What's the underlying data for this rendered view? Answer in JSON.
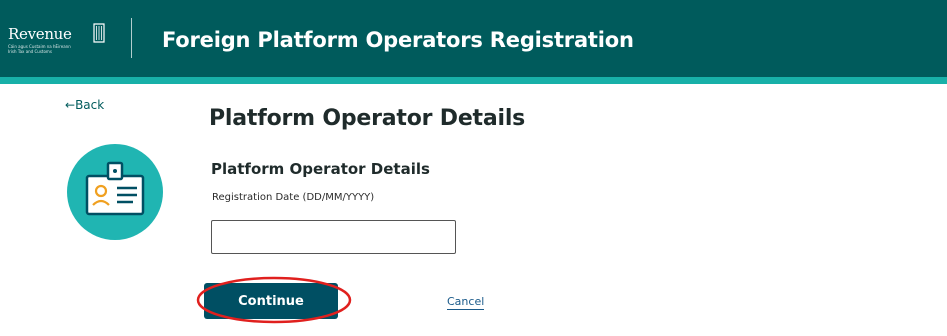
{
  "header": {
    "logo_text": "Revenue",
    "logo_subtext": [
      "Cáin agus Custaim na hÉireann",
      "Irish Tax and Customs"
    ],
    "title": "Foreign Platform Operators Registration"
  },
  "nav": {
    "back_label": "Back"
  },
  "page": {
    "heading": "Platform Operator Details",
    "section_heading": "Platform Operator Details",
    "field_label": "Registration Date (DD/MM/YYYY)",
    "date_value": "",
    "icon": "id-badge-icon"
  },
  "actions": {
    "continue_label": "Continue",
    "cancel_label": "Cancel"
  },
  "colors": {
    "header_bg": "#005b5c",
    "header_stripe": "#18b0a8",
    "icon_circle": "#20b5b2",
    "button_bg": "#004f63",
    "highlight": "#e0201e"
  }
}
